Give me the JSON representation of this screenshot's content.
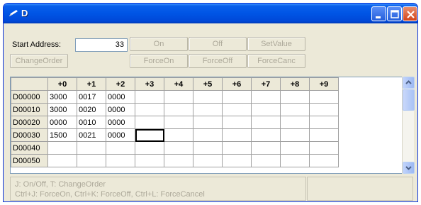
{
  "window": {
    "title": "D"
  },
  "toolbar": {
    "start_address_label": "Start Address:",
    "start_address_value": "33",
    "buttons": {
      "on": "On",
      "off": "Off",
      "setvalue": "SetValue",
      "changeorder": "ChangeOrder",
      "forceon": "ForceOn",
      "forceoff": "ForceOff",
      "forcecanc": "ForceCanc"
    }
  },
  "grid": {
    "columns": [
      "+0",
      "+1",
      "+2",
      "+3",
      "+4",
      "+5",
      "+6",
      "+7",
      "+8",
      "+9"
    ],
    "rows": [
      {
        "address": "D00000",
        "cells": [
          "3000",
          "0017",
          "0000",
          "",
          "",
          "",
          "",
          "",
          "",
          ""
        ]
      },
      {
        "address": "D00010",
        "cells": [
          "3000",
          "0020",
          "0000",
          "",
          "",
          "",
          "",
          "",
          "",
          ""
        ]
      },
      {
        "address": "D00020",
        "cells": [
          "0000",
          "0010",
          "0000",
          "",
          "",
          "",
          "",
          "",
          "",
          ""
        ]
      },
      {
        "address": "D00030",
        "cells": [
          "1500",
          "0021",
          "0000",
          "",
          "",
          "",
          "",
          "",
          "",
          ""
        ]
      },
      {
        "address": "D00040",
        "cells": [
          "",
          "",
          "",
          "",
          "",
          "",
          "",
          "",
          "",
          ""
        ]
      },
      {
        "address": "D00050",
        "cells": [
          "",
          "",
          "",
          "",
          "",
          "",
          "",
          "",
          "",
          ""
        ]
      }
    ],
    "selected": {
      "row": 3,
      "col": 3
    }
  },
  "status": {
    "line1": "J: On/Off,  T: ChangeOrder",
    "line2": "Ctrl+J: ForceOn,   Ctrl+K: ForceOff,    Ctrl+L: ForceCancel"
  }
}
